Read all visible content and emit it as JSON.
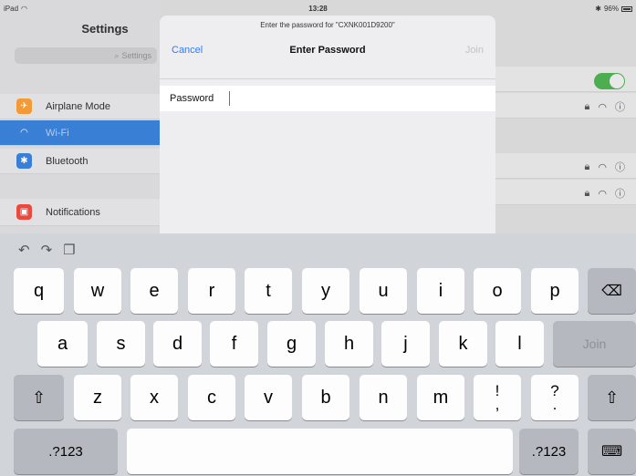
{
  "status_bar": {
    "device": "iPad",
    "time": "13:28",
    "battery": "96%"
  },
  "settings": {
    "title": "Settings",
    "search_placeholder": "Settings",
    "items": [
      {
        "label": "Airplane Mode",
        "icon": "airplane-icon",
        "color": "#f19a37"
      },
      {
        "label": "Wi-Fi",
        "icon": "wifi-icon",
        "color": "#3a7fd6",
        "selected": true
      },
      {
        "label": "Bluetooth",
        "icon": "bluetooth-icon",
        "color": "#3a7fd6"
      },
      {
        "label": "Notifications",
        "icon": "notifications-icon",
        "color": "#e84a3f"
      }
    ]
  },
  "modal": {
    "prompt": "Enter the password for \"CXNK001D9200\"",
    "cancel": "Cancel",
    "title": "Enter Password",
    "join": "Join",
    "password_label": "Password",
    "password_value": ""
  },
  "keyboard": {
    "row1": [
      "q",
      "w",
      "e",
      "r",
      "t",
      "y",
      "u",
      "i",
      "o",
      "p"
    ],
    "row2": [
      "a",
      "s",
      "d",
      "f",
      "g",
      "h",
      "j",
      "k",
      "l"
    ],
    "row3": [
      "z",
      "x",
      "c",
      "v",
      "b",
      "n",
      "m"
    ],
    "punct1": {
      "top": "!",
      "bottom": ","
    },
    "punct2": {
      "top": "?",
      "bottom": "."
    },
    "join": "Join",
    "numbers_left": ".?123",
    "numbers_right": ".?123"
  },
  "colors": {
    "accent": "#2f7cf6",
    "toggle_on": "#4cae4f",
    "keyboard_bg": "#d1d4d9"
  }
}
